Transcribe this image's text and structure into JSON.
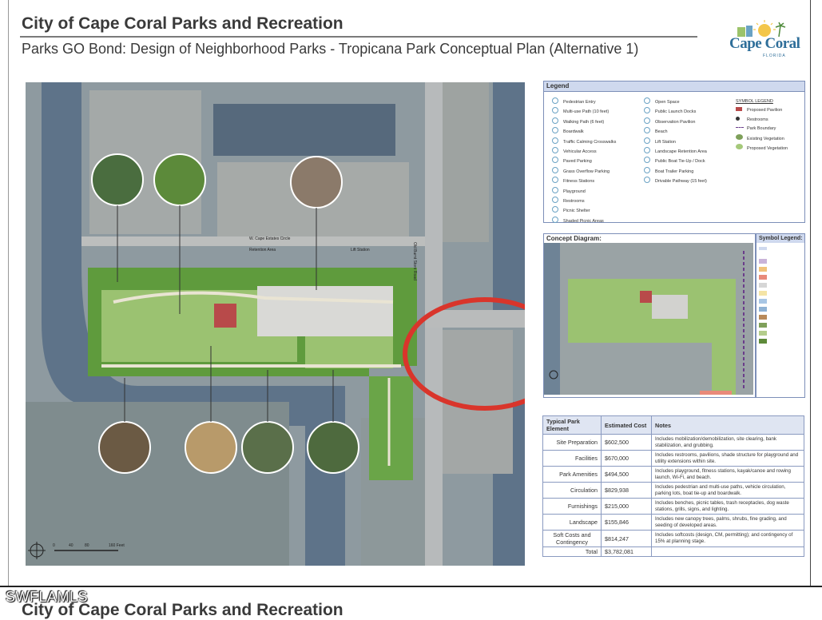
{
  "header": {
    "title": "City of Cape Coral Parks and Recreation",
    "subtitle": "Parks GO Bond: Design of Neighborhood Parks - Tropicana Park Conceptual Plan (Alternative 1)"
  },
  "logo": {
    "name": "Cape Coral",
    "tagline": "FLORIDA"
  },
  "map": {
    "labels": {
      "circle": "W. Cape Estates Circle",
      "retention": "Retention Area",
      "lift": "Lift Station",
      "road": "Old Burnt Store Road"
    },
    "scale": [
      "0",
      "40",
      "80",
      "160 Feet"
    ],
    "highlight_color": "#d9352b"
  },
  "legend": {
    "title": "Legend",
    "col1": [
      "Pedestrian Entry",
      "Multi-use Path (10 feet)",
      "Walking Path (6 feet)",
      "Boardwalk",
      "Traffic Calming Crosswalks",
      "Vehicular Access",
      "Paved Parking",
      "Grass Overflow Parking",
      "Fitness Stations",
      "Playground",
      "Restrooms",
      "Picnic Shelter",
      "Shaded Picnic Areas"
    ],
    "col2": [
      "Open Space",
      "Public Launch Docks",
      "Observation Pavilion",
      "Beach",
      "Lift Station",
      "Landscape Retention Area",
      "Public Boat Tie-Up / Dock",
      "Boat Trailer Parking",
      "Drivable Pathway (15 feet)"
    ],
    "symbol_title": "SYMBOL LEGEND",
    "symbols": [
      "Proposed Pavilion",
      "Restrooms",
      "Park Boundary",
      "Existing Vegetation",
      "Proposed Vegetation"
    ]
  },
  "concept": {
    "title": "Concept Diagram:",
    "symbol_title": "Symbol Legend:"
  },
  "cost_table": {
    "headers": [
      "Typical Park Element",
      "Estimated Cost",
      "Notes"
    ],
    "rows": [
      {
        "element": "Site Preparation",
        "cost": "$602,500",
        "notes": "Includes mobilization/demobilization, site clearing, bank stabilization, and grubbing."
      },
      {
        "element": "Facilities",
        "cost": "$670,000",
        "notes": "Includes restrooms, pavilions, shade structure for playground and utility extensions within site."
      },
      {
        "element": "Park Amenities",
        "cost": "$494,500",
        "notes": "Includes playground, fitness stations, kayak/canoe and rowing launch, Wi-Fi, and beach."
      },
      {
        "element": "Circulation",
        "cost": "$829,938",
        "notes": "Includes pedestrian and multi-use paths, vehicle circulation, parking lots, boat tie-up and boardwalk."
      },
      {
        "element": "Furnishings",
        "cost": "$215,000",
        "notes": "Includes benches, picnic tables, trash receptacles, dog waste stations, grills, signs, and lighting."
      },
      {
        "element": "Landscape",
        "cost": "$155,846",
        "notes": "Includes new canopy trees, palms, shrubs, fine grading, and seeding of developed areas."
      },
      {
        "element": "Soft Costs and Contingency",
        "cost": "$814,247",
        "notes": "Includes softcosts (design, CM, permitting); and contingency of 15% at planning stage."
      },
      {
        "element": "Total",
        "cost": "$3,782,081",
        "notes": ""
      }
    ]
  },
  "watermark": "SWFLAMLS",
  "next_page_title": "City of Cape Coral Parks and Recreation"
}
